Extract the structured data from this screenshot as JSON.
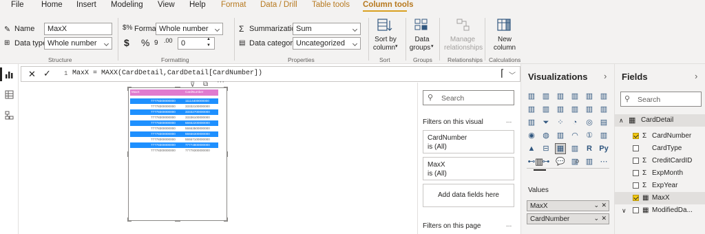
{
  "menu": {
    "items": [
      "File",
      "Home",
      "Insert",
      "Modeling",
      "View",
      "Help"
    ],
    "context_items": [
      "Format",
      "Data / Drill",
      "Table tools"
    ],
    "active_item": "Column tools"
  },
  "ribbon": {
    "structure": {
      "name_label": "Name",
      "name_value": "MaxX",
      "datatype_label": "Data type",
      "datatype_value": "Whole number",
      "group_label": "Structure"
    },
    "formatting": {
      "format_label": "Format",
      "format_value": "Whole number",
      "currency_symbol": "$",
      "percent_symbol": "%",
      "comma_symbol": "9",
      "decimal_symbol": ".00",
      "decimals_value": "0",
      "group_label": "Formatting"
    },
    "properties": {
      "summarization_label": "Summarization",
      "summarization_value": "Sum",
      "category_label": "Data category",
      "category_value": "Uncategorized",
      "group_label": "Properties"
    },
    "sort": {
      "button_line1": "Sort by",
      "button_line2": "column",
      "group_label": "Sort"
    },
    "groups": {
      "button_line1": "Data",
      "button_line2": "groups",
      "group_label": "Groups"
    },
    "relationships": {
      "button_line1": "Manage",
      "button_line2": "relationships",
      "group_label": "Relationships"
    },
    "calculations": {
      "button_line1": "New",
      "button_line2": "column",
      "group_label": "Calculations"
    }
  },
  "formula": {
    "line_number": "1",
    "text": "MaxX = MAXX(CardDetail,CardDetail[CardNumber])"
  },
  "table_visual": {
    "headers": [
      "MaxX",
      "CardNumber"
    ],
    "rows": [
      {
        "maxx": "77778300000000",
        "card": "11114400000000"
      },
      {
        "maxx": "77778300000000",
        "card": "33332100000000"
      },
      {
        "maxx": "77778300000000",
        "card": "33332700000000"
      },
      {
        "maxx": "77778300000000",
        "card": "33336100000000"
      },
      {
        "maxx": "77778300000000",
        "card": "55552200000000"
      },
      {
        "maxx": "77778300000000",
        "card": "55553500000000"
      },
      {
        "maxx": "77778300000000",
        "card": "55556300000000"
      },
      {
        "maxx": "77778300000000",
        "card": "55557100000000"
      },
      {
        "maxx": "77778300000000",
        "card": "77774800000000"
      },
      {
        "maxx": "77778300000000",
        "card": "77778300000000"
      }
    ],
    "selected_rows": [
      0,
      2,
      4,
      6,
      8
    ]
  },
  "filters": {
    "search_placeholder": "Search",
    "on_visual_label": "Filters on this visual",
    "cards": [
      {
        "name": "CardNumber",
        "value": "is (All)"
      },
      {
        "name": "MaxX",
        "value": "is (All)"
      }
    ],
    "add_fields": "Add data fields here",
    "on_page_label": "Filters on this page",
    "more": "..."
  },
  "visualizations": {
    "title": "Visualizations",
    "values_label": "Values",
    "value_fields": [
      "MaxX",
      "CardNumber"
    ]
  },
  "fields": {
    "title": "Fields",
    "search_placeholder": "Search",
    "table_name": "CardDetail",
    "items": [
      {
        "name": "CardNumber",
        "checked": true,
        "sigma": true
      },
      {
        "name": "CardType",
        "checked": false,
        "sigma": false
      },
      {
        "name": "CreditCardID",
        "checked": false,
        "sigma": true
      },
      {
        "name": "ExpMonth",
        "checked": false,
        "sigma": true
      },
      {
        "name": "ExpYear",
        "checked": false,
        "sigma": true
      },
      {
        "name": "MaxX",
        "checked": true,
        "sigma": false
      },
      {
        "name": "ModifiedDa...",
        "checked": false,
        "sigma": false
      }
    ]
  },
  "colors": {
    "accent": "#d9a020",
    "header_pink": "#e07bcf",
    "row_blue": "#1e90ff",
    "pane_bg": "#f3f2f1"
  }
}
